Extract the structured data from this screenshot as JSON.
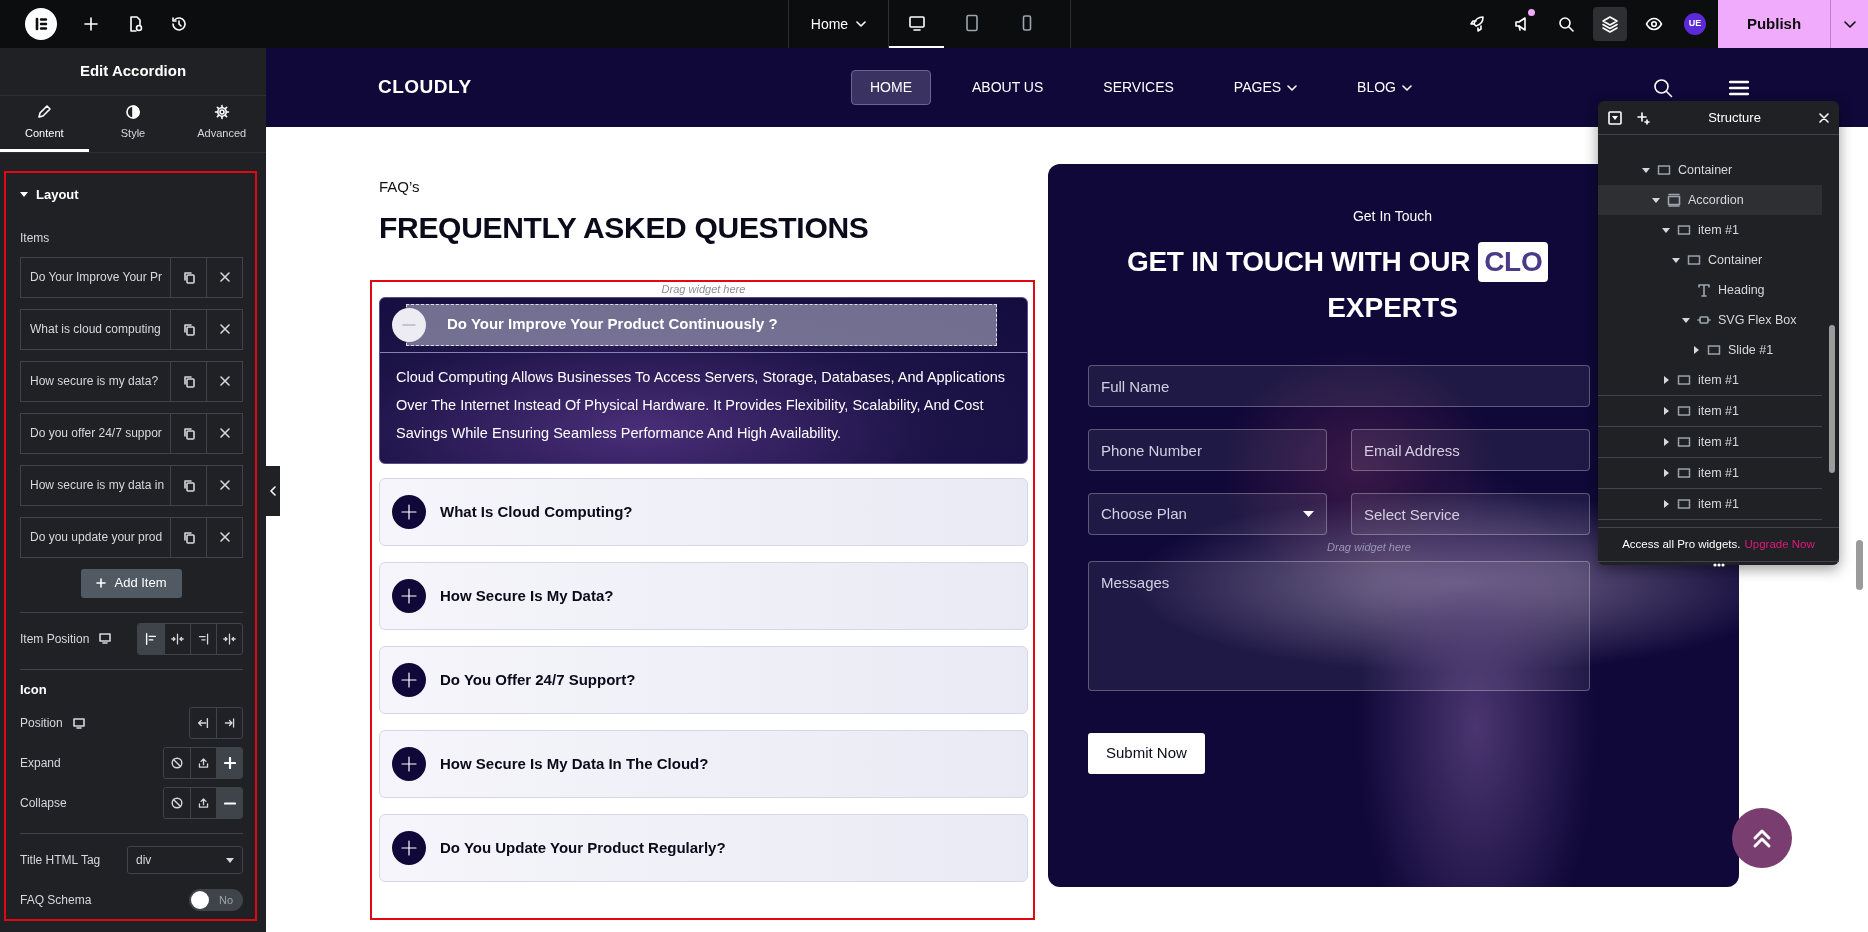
{
  "topbar": {
    "page": "Home",
    "devices": [
      {
        "kind": "desktop",
        "selected": true
      },
      {
        "kind": "tablet",
        "selected": false
      },
      {
        "kind": "mobile",
        "selected": false
      }
    ],
    "tools": [
      {
        "kind": "rocket",
        "selected": false
      },
      {
        "kind": "megaphone",
        "selected": false,
        "notification": true
      },
      {
        "kind": "search",
        "selected": false
      },
      {
        "kind": "layers",
        "selected": true
      },
      {
        "kind": "eye",
        "selected": false
      }
    ],
    "avatar": "UE",
    "publish": "Publish"
  },
  "panel": {
    "title": "Edit Accordion",
    "tabs": [
      {
        "label": "Content",
        "kind": "pencil",
        "selected": true
      },
      {
        "label": "Style",
        "kind": "contrast",
        "selected": false
      },
      {
        "label": "Advanced",
        "kind": "gear",
        "selected": false
      }
    ],
    "section": {
      "title": "Layout",
      "expanded": true,
      "items_label": "Items",
      "items": [
        "Do Your Improve Your Pr",
        "What is cloud computing",
        "How secure is my data?",
        "Do you offer 24/7 suppor",
        "How secure is my data in",
        "Do you update your prod"
      ],
      "add_label": "Add Item",
      "item_position": {
        "label": "Item Position",
        "options": [
          {
            "kind": "start",
            "selected": true
          },
          {
            "kind": "center",
            "selected": false
          },
          {
            "kind": "end",
            "selected": false
          },
          {
            "kind": "stretch",
            "selected": false
          }
        ]
      },
      "icon_heading": "Icon",
      "icon_position": {
        "label": "Position",
        "options": [
          {
            "kind": "start",
            "selected": false
          },
          {
            "kind": "end",
            "selected": false
          }
        ]
      },
      "expand": {
        "label": "Expand",
        "options": [
          {
            "kind": "none",
            "selected": false
          },
          {
            "kind": "upload",
            "selected": false
          },
          {
            "kind": "plus",
            "selected": true
          }
        ]
      },
      "collapse": {
        "label": "Collapse",
        "options": [
          {
            "kind": "none",
            "selected": false
          },
          {
            "kind": "upload",
            "selected": false
          },
          {
            "kind": "minus",
            "selected": true
          }
        ]
      },
      "title_tag": {
        "label": "Title HTML Tag",
        "value": "div"
      },
      "faq_schema": {
        "label": "FAQ Schema",
        "on": false,
        "text": "No"
      }
    }
  },
  "site": {
    "logo": "CLOUDLY",
    "links": [
      {
        "label": "HOME",
        "selected": true,
        "dropdown": false
      },
      {
        "label": "ABOUT US",
        "selected": false,
        "dropdown": false
      },
      {
        "label": "SERVICES",
        "selected": false,
        "dropdown": false
      },
      {
        "label": "PAGES",
        "selected": false,
        "dropdown": true
      },
      {
        "label": "BLOG",
        "selected": false,
        "dropdown": true
      }
    ]
  },
  "faq": {
    "eyebrow": "FAQ’s",
    "title": "FREQUENTLY ASKED QUESTIONS",
    "drag_hint": "Drag widget here",
    "items": [
      {
        "title": "Do Your Improve Your Product Continuously ?",
        "expanded": true,
        "body": "Cloud Computing Allows Businesses To Access Servers, Storage, Databases, And Applications Over The Internet Instead Of Physical Hardware. It Provides Flexibility, Scalability, And Cost Savings While Ensuring Seamless Performance And High Availability."
      },
      {
        "title": "What Is Cloud Computing?",
        "expanded": false
      },
      {
        "title": "How Secure Is My Data?",
        "expanded": false
      },
      {
        "title": "Do You Offer 24/7 Support?",
        "expanded": false
      },
      {
        "title": "How Secure Is My Data In The Cloud?",
        "expanded": false
      },
      {
        "title": "Do You Update Your Product Regularly?",
        "expanded": false
      }
    ]
  },
  "contact": {
    "eyebrow": "Get In Touch",
    "title": "GET IN TOUCH WITH OUR",
    "highlight": "CLO",
    "title_line2": "EXPERTS",
    "rows": [
      [
        {
          "kind": "input",
          "placeholder": "Full Name"
        }
      ],
      [
        {
          "kind": "input",
          "placeholder": "Phone Number"
        },
        {
          "kind": "input",
          "placeholder": "Email Address"
        }
      ],
      [
        {
          "kind": "select",
          "placeholder": "Choose Plan"
        },
        {
          "kind": "input",
          "placeholder": "Select Service"
        }
      ],
      [
        {
          "kind": "textarea",
          "placeholder": "Messages"
        }
      ]
    ],
    "drag_hint": "Drag widget here",
    "submit": "Submit Now"
  },
  "structure": {
    "title": "Structure",
    "tree": [
      {
        "label": "Container",
        "kind": "container",
        "selected": false,
        "expanded": true,
        "children": [
          {
            "label": "Accordion",
            "kind": "accordion",
            "selected": true,
            "expanded": true,
            "children": [
              {
                "label": "item #1",
                "kind": "container",
                "selected": false,
                "expanded": true,
                "children": [
                  {
                    "label": "Container",
                    "kind": "container",
                    "selected": false,
                    "expanded": true,
                    "children": [
                      {
                        "label": "Heading",
                        "kind": "heading",
                        "selected": false
                      },
                      {
                        "label": "SVG Flex Box",
                        "kind": "flexbox",
                        "selected": false,
                        "expanded": true,
                        "children": [
                          {
                            "label": "Slide #1",
                            "kind": "container",
                            "selected": false,
                            "expanded": false
                          }
                        ]
                      }
                    ]
                  }
                ]
              },
              {
                "label": "item #1",
                "kind": "container",
                "selected": false,
                "expanded": false
              },
              {
                "label": "item #1",
                "kind": "container",
                "selected": false,
                "expanded": false
              },
              {
                "label": "item #1",
                "kind": "container",
                "selected": false,
                "expanded": false
              },
              {
                "label": "item #1",
                "kind": "container",
                "selected": false,
                "expanded": false
              },
              {
                "label": "item #1",
                "kind": "container",
                "selected": false,
                "expanded": false
              }
            ]
          }
        ]
      }
    ],
    "promo": "Access all Pro widgets.",
    "upgrade": "Upgrade Now"
  }
}
